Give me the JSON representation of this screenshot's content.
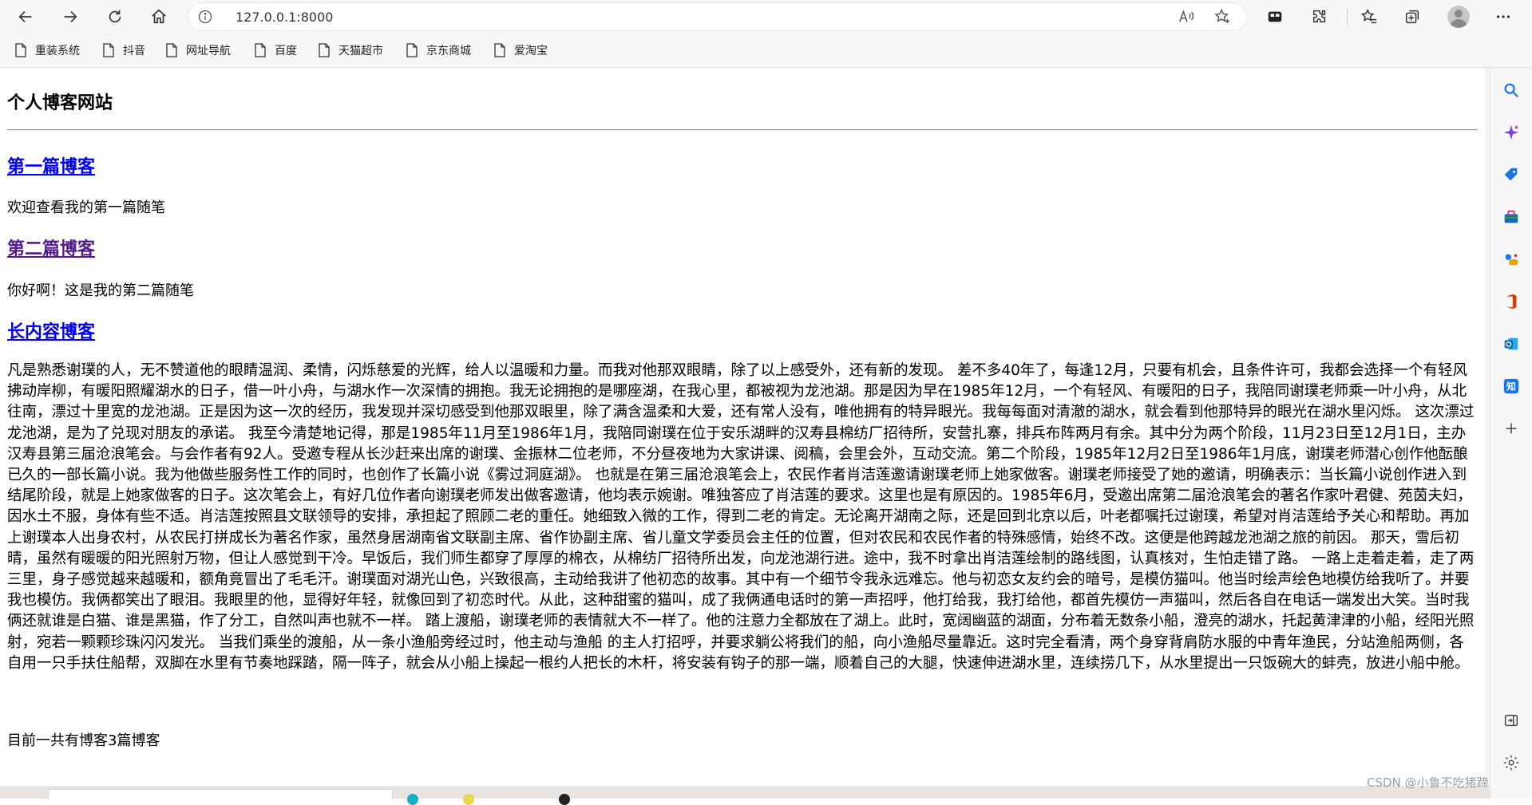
{
  "browser": {
    "url": "127.0.0.1:8000",
    "bookmarks": [
      {
        "label": "重装系统"
      },
      {
        "label": "抖音"
      },
      {
        "label": "网址导航"
      },
      {
        "label": "百度"
      },
      {
        "label": "天猫超市"
      },
      {
        "label": "京东商城"
      },
      {
        "label": "爱淘宝"
      }
    ],
    "read_aloud_label": "A"
  },
  "page": {
    "site_title": "个人博客网站",
    "posts": [
      {
        "title": "第一篇博客",
        "summary": "欢迎查看我的第一篇随笔"
      },
      {
        "title": "第二篇博客",
        "summary": "你好啊！这是我的第二篇随笔"
      },
      {
        "title": "长内容博客",
        "summary": "凡是熟悉谢璞的人，无不赞道他的眼睛温润、柔情，闪烁慈爱的光辉，给人以温暖和力量。而我对他那双眼睛，除了以上感受外，还有新的发现。 差不多40年了，每逢12月，只要有机会，且条件许可，我都会选择一个有轻风拂动岸柳，有暖阳照耀湖水的日子，借一叶小舟，与湖水作一次深情的拥抱。我无论拥抱的是哪座湖，在我心里，都被视为龙池湖。那是因为早在1985年12月，一个有轻风、有暖阳的日子，我陪同谢璞老师乘一叶小舟，从北往南，漂过十里宽的龙池湖。正是因为这一次的经历，我发现并深切感受到他那双眼里，除了满含温柔和大爱，还有常人没有，唯他拥有的特异眼光。我每每面对清澈的湖水，就会看到他那特异的眼光在湖水里闪烁。 这次漂过龙池湖，是为了兑现对朋友的承诺。 我至今清楚地记得，那是1985年11月至1986年1月，我陪同谢璞在位于安乐湖畔的汉寿县棉纺厂招待所，安营扎寨，排兵布阵两月有余。其中分为两个阶段，11月23日至12月1日，主办汉寿县第三届沧浪笔会。与会作者有92人。受邀专程从长沙赶来出席的谢璞、金振林二位老师，不分昼夜地为大家讲课、阅稿，会里会外，互动交流。第二个阶段，1985年12月2日至1986年1月底，谢璞老师潜心创作他酝酿已久的一部长篇小说。我为他做些服务性工作的同时，也创作了长篇小说《雾过洞庭湖》。 也就是在第三届沧浪笔会上，农民作者肖洁莲邀请谢璞老师上她家做客。谢璞老师接受了她的邀请，明确表示：当长篇小说创作进入到结尾阶段，就是上她家做客的日子。这次笔会上，有好几位作者向谢璞老师发出做客邀请，他均表示婉谢。唯独答应了肖洁莲的要求。这里也是有原因的。1985年6月，受邀出席第二届沧浪笔会的著名作家叶君健、苑茵夫妇，因水土不服，身体有些不适。肖洁莲按照县文联领导的安排，承担起了照顾二老的重任。她细致入微的工作，得到二老的肯定。无论离开湖南之际，还是回到北京以后，叶老都嘱托过谢璞，希望对肖洁莲给予关心和帮助。再加上谢璞本人出身农村，从农民打拼成长为著名作家，虽然身居湖南省文联副主席、省作协副主席、省儿童文学委员会主任的位置，但对农民和农民作者的特殊感情，始终不改。这便是他跨越龙池湖之旅的前因。 那天，雪后初晴，虽然有暖暖的阳光照射万物，但让人感觉到干冷。早饭后，我们师生都穿了厚厚的棉衣，从棉纺厂招待所出发，向龙池湖行进。途中，我不时拿出肖洁莲绘制的路线图，认真核对，生怕走错了路。 一路上走着走着，走了两三里，身子感觉越来越暖和，额角竟冒出了毛毛汗。谢璞面对湖光山色，兴致很高，主动给我讲了他初恋的故事。其中有一个细节令我永远难忘。他与初恋女友约会的暗号，是模仿猫叫。他当时绘声绘色地模仿给我听了。并要我也模仿。我俩都笑出了眼泪。我眼里的他，显得好年轻，就像回到了初恋时代。从此，这种甜蜜的猫叫，成了我俩通电话时的第一声招呼，他打给我，我打给他，都首先模仿一声猫叫，然后各自在电话一端发出大笑。当时我俩还就谁是白猫、谁是黑猫，作了分工，自然叫声也就不一样。 踏上渡船，谢璞老师的表情就大不一样了。他的注意力全都放在了湖上。此时，宽阔幽蓝的湖面，分布着无数条小船，澄亮的湖水，托起黄津津的小船，经阳光照射，宛若一颗颗珍珠闪闪发光。 当我们乘坐的渡船，从一条小渔船旁经过时，他主动与渔船 的主人打招呼，并要求躺公将我们的船，向小渔船尽量靠近。这时完全看清，两个身穿背肩防水服的中青年渔民，分站渔船两侧，各自用一只手扶住船帮，双脚在水里有节奏地踩踏，隔一阵子，就会从小船上操起一根约人把长的木杆，将安装有钩子的那一端，顺着自己的大腿，快速伸进湖水里，连续捞几下，从水里提出一只饭碗大的蚌壳，放进小船中舱。"
      }
    ],
    "footer": "目前一共有博客3篇博客"
  },
  "watermark": "CSDN @小鲁不吃猪蹄",
  "icons": {
    "back": "arrow-left-icon",
    "forward": "arrow-right-icon",
    "refresh": "refresh-icon",
    "home": "home-icon",
    "info": "info-icon",
    "read_aloud": "read-aloud-icon",
    "favorite_add": "star-plus-icon",
    "extension": "puzzle-icon",
    "favorites": "star-list-icon",
    "collections": "collections-icon",
    "more": "more-dots-icon"
  },
  "colors": {
    "link": "#0000ee",
    "visited": "#551a8b",
    "chrome_bg": "#f7f7f7"
  }
}
